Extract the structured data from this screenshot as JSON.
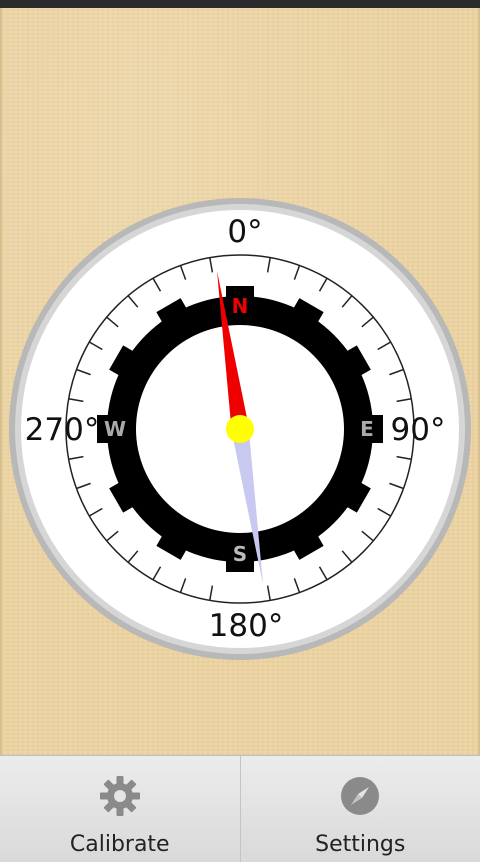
{
  "compass": {
    "degree_labels": {
      "north": "0°",
      "east": "90°",
      "south": "180°",
      "west": "270°"
    },
    "cardinals": {
      "north": "N",
      "east": "E",
      "south": "S",
      "west": "W"
    },
    "needle_colors": {
      "north": "#ee0000",
      "south": "#c8c8f0",
      "pivot": "#ffff00"
    },
    "ring_color": "#000000"
  },
  "bottom_bar": {
    "calibrate": {
      "label": "Calibrate",
      "icon": "gear-icon"
    },
    "settings": {
      "label": "Settings",
      "icon": "compass-icon"
    }
  }
}
